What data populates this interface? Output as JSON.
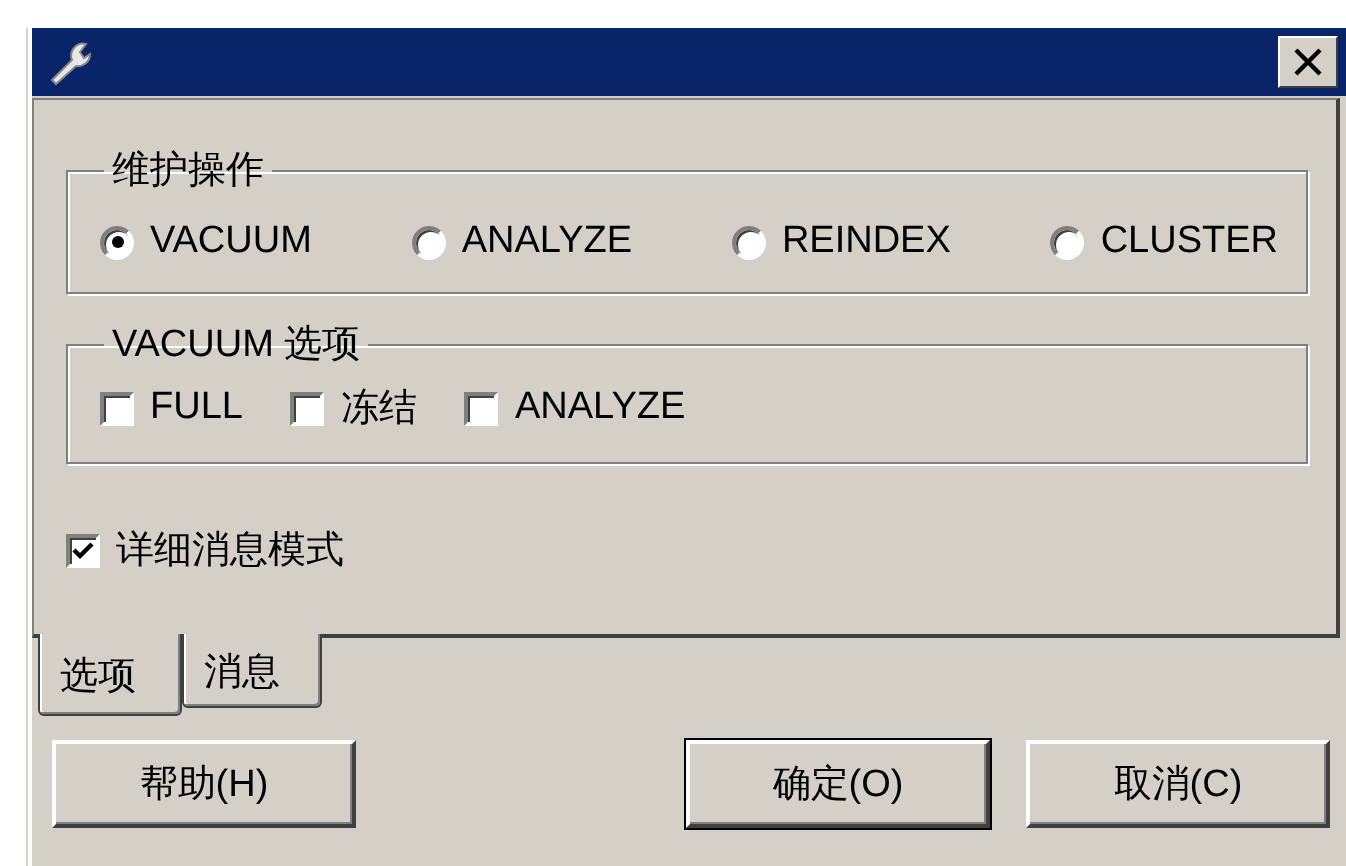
{
  "maintenance_group": {
    "title": "维护操作",
    "options": [
      {
        "label": "VACUUM",
        "selected": true
      },
      {
        "label": "ANALYZE",
        "selected": false
      },
      {
        "label": "REINDEX",
        "selected": false
      },
      {
        "label": "CLUSTER",
        "selected": false
      }
    ]
  },
  "vacuum_options_group": {
    "title": "VACUUM 选项",
    "options": [
      {
        "label": "FULL",
        "checked": false
      },
      {
        "label": "冻结",
        "checked": false
      },
      {
        "label": "ANALYZE",
        "checked": false
      }
    ]
  },
  "verbose_checkbox": {
    "label": "详细消息模式",
    "checked": true
  },
  "tabs": [
    {
      "label": "选项",
      "selected": true
    },
    {
      "label": "消息",
      "selected": false
    }
  ],
  "buttons": [
    {
      "label": "帮助(H)",
      "default": false
    },
    {
      "label": "确定(O)",
      "default": true
    },
    {
      "label": "取消(C)",
      "default": false
    }
  ]
}
